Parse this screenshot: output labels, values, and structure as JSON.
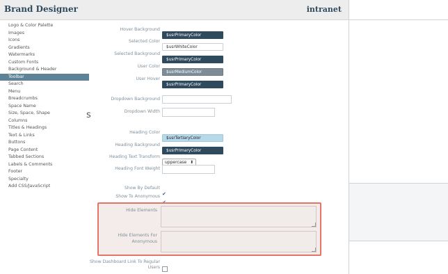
{
  "header": {
    "title": "Brand Designer",
    "right_label": "intranet"
  },
  "sidebar": {
    "items": [
      {
        "label": "Logo & Color Palette"
      },
      {
        "label": "Images"
      },
      {
        "label": "Icons"
      },
      {
        "label": "Gradients"
      },
      {
        "label": "Watermarks"
      },
      {
        "label": "Custom Fonts"
      },
      {
        "label": "Background & Header"
      },
      {
        "label": "Toolbar",
        "active": true
      },
      {
        "label": "Search"
      },
      {
        "label": "Menu"
      },
      {
        "label": "Breadcrumbs"
      },
      {
        "label": "Space Name"
      },
      {
        "label": "Size, Space, Shape"
      },
      {
        "label": "Columns"
      },
      {
        "label": "Titles & Headings"
      },
      {
        "label": "Text & Links"
      },
      {
        "label": "Buttons"
      },
      {
        "label": "Page Content"
      },
      {
        "label": "Tabbed Sections"
      },
      {
        "label": "Labels & Comments"
      },
      {
        "label": "Footer"
      },
      {
        "label": "Specialty"
      },
      {
        "label": "Add CSS/JavaScript"
      }
    ]
  },
  "form": {
    "hover_background": {
      "label": "Hover Background",
      "value": "$usrPrimaryColor"
    },
    "selected_color": {
      "label": "Selected Color",
      "value": "$usrWhiteColor"
    },
    "selected_background": {
      "label": "Selected Background",
      "value": "$usrPrimaryColor"
    },
    "user_color": {
      "label": "User Color",
      "value": "$usrMediumColor"
    },
    "user_hover": {
      "label": "User Hover",
      "value": "$usrPrimaryColor"
    },
    "dropdown_background": {
      "label": "Dropdown Background",
      "value": ""
    },
    "dropdown_width": {
      "label": "Dropdown Width",
      "value": ""
    },
    "heading_color": {
      "label": "Heading Color",
      "value": "$usrTertiaryColor"
    },
    "heading_background": {
      "label": "Heading Background",
      "value": "$usrPrimaryColor"
    },
    "heading_text_transform": {
      "label": "Heading Text Transform",
      "value": "uppercase",
      "arrow": "⬍"
    },
    "heading_font_weight": {
      "label": "Heading Font Weight",
      "value": ""
    },
    "show_by_default": {
      "label": "Show By Default",
      "checked": true
    },
    "show_to_anonymous": {
      "label": "Show To Anonymous",
      "checked": true
    },
    "hide_elements": {
      "label": "Hide Elements",
      "value": ""
    },
    "hide_elements_anonymous": {
      "label": "Hide Elements For Anonymous",
      "value": ""
    },
    "show_dashboard_link": {
      "label": "Show Dashboard Link To Regular Users",
      "checked": false
    }
  },
  "cutoff_text": "s"
}
